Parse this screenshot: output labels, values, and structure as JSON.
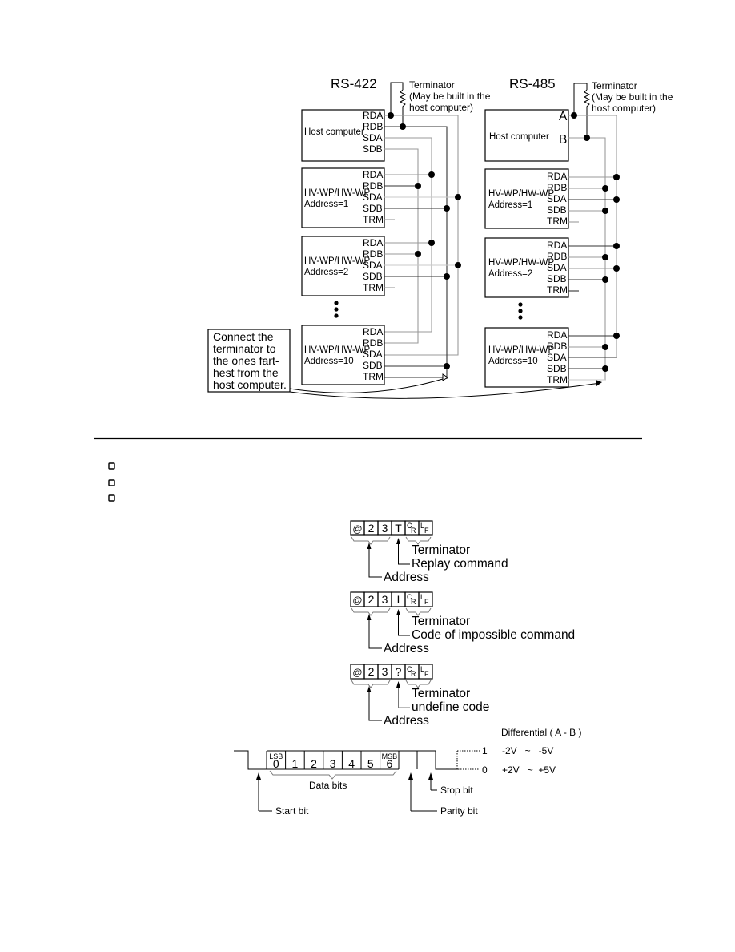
{
  "wiring": {
    "rs422": {
      "title": "RS-422",
      "terminator_note": [
        "Terminator",
        "(May be built in the",
        "host computer)"
      ],
      "host": {
        "label": "Host computer",
        "pins": [
          "RDA",
          "RDB",
          "SDA",
          "SDB"
        ]
      },
      "devices": [
        {
          "model": "HV-WP/HW-WP",
          "address": "Address=1",
          "pins": [
            "RDA",
            "RDB",
            "SDA",
            "SDB",
            "TRM"
          ]
        },
        {
          "model": "HV-WP/HW-WP",
          "address": "Address=2",
          "pins": [
            "RDA",
            "RDB",
            "SDA",
            "SDB",
            "TRM"
          ]
        },
        {
          "model": "HV-WP/HW-WP",
          "address": "Address=10",
          "pins": [
            "RDA",
            "RDB",
            "SDA",
            "SDB",
            "TRM"
          ]
        }
      ]
    },
    "rs485": {
      "title": "RS-485",
      "terminator_note": [
        "Terminator",
        "(May be built in the",
        "host computer)"
      ],
      "host": {
        "label": "Host computer",
        "pins": [
          "A",
          "B"
        ]
      },
      "devices": [
        {
          "model": "HV-WP/HW-WP",
          "address": "Address=1",
          "pins": [
            "RDA",
            "RDB",
            "SDA",
            "SDB",
            "TRM"
          ]
        },
        {
          "model": "HV-WP/HW-WP",
          "address": "Address=2",
          "pins": [
            "RDA",
            "RDB",
            "SDA",
            "SDB",
            "TRM"
          ]
        },
        {
          "model": "HV-WP/HW-WP",
          "address": "Address=10",
          "pins": [
            "RDA",
            "RDB",
            "SDA",
            "SDB",
            "TRM"
          ]
        }
      ]
    },
    "callout": [
      "Connect  the",
      "terminator to",
      "the ones fart-",
      "hest from the",
      "host computer."
    ]
  },
  "checklist": {
    "count": 3
  },
  "responses": [
    {
      "cells": [
        "@",
        "2",
        "3",
        "T"
      ],
      "terminator": "Terminator",
      "code_label": "Replay command",
      "address_label": "Address"
    },
    {
      "cells": [
        "@",
        "2",
        "3",
        "I"
      ],
      "terminator": "Terminator",
      "code_label": "Code of impossible command",
      "address_label": "Address"
    },
    {
      "cells": [
        "@",
        "2",
        "3",
        "?"
      ],
      "terminator": "Terminator",
      "code_label": "undefine code",
      "address_label": "Address"
    }
  ],
  "crlf": {
    "cr": [
      "C",
      "R"
    ],
    "lf": [
      "L",
      "F"
    ]
  },
  "frame": {
    "data_bits": [
      "0",
      "1",
      "2",
      "3",
      "4",
      "5",
      "6"
    ],
    "lsb": "LSB",
    "msb": "MSB",
    "data_bits_label": "Data bits",
    "start_bit": "Start bit",
    "parity_bit": "Parity bit",
    "stop_bit": "Stop bit",
    "differential_title": "Differential ( A - B )",
    "levels": [
      {
        "bit": "1",
        "range": "-2V   ~   -5V"
      },
      {
        "bit": "0",
        "range": "+2V   ~  +5V"
      }
    ]
  }
}
